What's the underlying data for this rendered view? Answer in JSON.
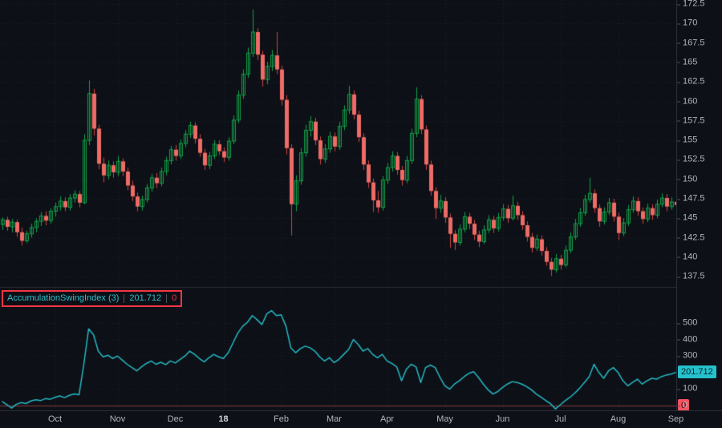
{
  "colors": {
    "bg": "#0d1016",
    "grid": "#1e232d",
    "axis_text": "#b2b5be",
    "axis_text_major": "#d1d4dc",
    "pane_border": "#2a2e39",
    "up": "#12a049",
    "down_body": "#ee6b66",
    "down_wick": "#cc4441",
    "line": "#25b8c4",
    "zero_line": "#8a3a3a",
    "selection_border": "#f23645",
    "value_box_bg": "#25c1cc",
    "value_box_text": "#072329",
    "zero_box_bg": "#f7525f",
    "zero_box_text": "#2b0a0d"
  },
  "indicator": {
    "name": "AccumulationSwingIndex (3)",
    "value": "201.712",
    "zero_value": "0"
  },
  "chart_data": [
    {
      "type": "candlestick",
      "title": "",
      "ylim": [
        136.2,
        173.0
      ],
      "grid": true,
      "y_ticks": [
        172.5,
        170,
        167.5,
        165,
        162.5,
        160,
        157.5,
        155,
        152.5,
        150,
        147.5,
        145,
        142.5,
        140,
        137.5
      ],
      "x_ticks": [
        {
          "index": 11,
          "label": "Oct"
        },
        {
          "index": 24,
          "label": "Nov"
        },
        {
          "index": 36,
          "label": "Dec"
        },
        {
          "index": 46,
          "label": "18",
          "major": true
        },
        {
          "index": 58,
          "label": "Feb"
        },
        {
          "index": 69,
          "label": "Mar"
        },
        {
          "index": 80,
          "label": "Apr"
        },
        {
          "index": 92,
          "label": "May"
        },
        {
          "index": 104,
          "label": "Jun"
        },
        {
          "index": 116,
          "label": "Jul"
        },
        {
          "index": 128,
          "label": "Aug"
        },
        {
          "index": 140,
          "label": "Sep"
        }
      ],
      "candles_format": [
        "open",
        "high",
        "low",
        "close"
      ],
      "candles": [
        [
          144.2,
          145.1,
          143.5,
          144.8
        ],
        [
          144.8,
          145.2,
          143.4,
          143.9
        ],
        [
          143.9,
          144.9,
          143.2,
          144.5
        ],
        [
          144.5,
          144.8,
          142.6,
          143.2
        ],
        [
          143.2,
          143.8,
          141.5,
          142.1
        ],
        [
          142.1,
          143.4,
          141.8,
          143.0
        ],
        [
          143.0,
          144.3,
          142.5,
          143.8
        ],
        [
          143.8,
          145.0,
          143.2,
          144.6
        ],
        [
          144.6,
          145.8,
          144.0,
          145.3
        ],
        [
          145.3,
          145.9,
          144.1,
          144.7
        ],
        [
          144.7,
          146.3,
          144.3,
          145.9
        ],
        [
          145.9,
          147.0,
          145.2,
          146.5
        ],
        [
          146.5,
          147.8,
          146.0,
          147.2
        ],
        [
          147.2,
          147.7,
          145.9,
          146.4
        ],
        [
          146.4,
          148.1,
          146.0,
          147.6
        ],
        [
          147.6,
          148.6,
          147.0,
          148.1
        ],
        [
          148.1,
          148.5,
          146.4,
          147.0
        ],
        [
          147.0,
          155.8,
          146.8,
          155.0
        ],
        [
          155.0,
          162.7,
          154.4,
          161.0
        ],
        [
          161.0,
          161.6,
          155.6,
          156.5
        ],
        [
          156.5,
          157.0,
          151.3,
          152.0
        ],
        [
          152.0,
          152.8,
          149.6,
          150.5
        ],
        [
          150.5,
          152.4,
          150.0,
          151.8
        ],
        [
          151.8,
          152.3,
          150.2,
          150.9
        ],
        [
          150.9,
          153.0,
          150.4,
          152.3
        ],
        [
          152.3,
          152.7,
          150.4,
          151.0
        ],
        [
          151.0,
          151.5,
          148.6,
          149.2
        ],
        [
          149.2,
          149.8,
          147.2,
          147.8
        ],
        [
          147.8,
          148.3,
          145.9,
          146.5
        ],
        [
          146.5,
          147.9,
          146.0,
          147.4
        ],
        [
          147.4,
          149.4,
          147.0,
          148.9
        ],
        [
          148.9,
          150.7,
          148.4,
          150.2
        ],
        [
          150.2,
          150.8,
          148.9,
          149.5
        ],
        [
          149.5,
          151.5,
          149.1,
          151.0
        ],
        [
          151.0,
          152.9,
          150.5,
          152.4
        ],
        [
          152.4,
          154.3,
          151.9,
          153.8
        ],
        [
          153.8,
          154.4,
          152.4,
          153.0
        ],
        [
          153.0,
          155.1,
          152.6,
          154.6
        ],
        [
          154.6,
          156.3,
          154.1,
          155.8
        ],
        [
          155.8,
          157.4,
          155.3,
          156.9
        ],
        [
          156.9,
          157.3,
          154.6,
          155.2
        ],
        [
          155.2,
          155.8,
          152.9,
          153.4
        ],
        [
          153.4,
          153.9,
          151.2,
          151.8
        ],
        [
          151.8,
          153.5,
          151.3,
          153.0
        ],
        [
          153.0,
          155.0,
          152.6,
          154.5
        ],
        [
          154.5,
          155.0,
          153.1,
          153.6
        ],
        [
          153.6,
          154.1,
          152.2,
          152.8
        ],
        [
          152.8,
          155.4,
          152.4,
          154.9
        ],
        [
          154.9,
          158.2,
          154.5,
          157.6
        ],
        [
          157.6,
          161.4,
          157.2,
          160.8
        ],
        [
          160.8,
          164.1,
          160.3,
          163.5
        ],
        [
          163.5,
          166.9,
          163.0,
          166.2
        ],
        [
          166.2,
          171.8,
          165.7,
          168.9
        ],
        [
          168.9,
          169.4,
          165.3,
          166.0
        ],
        [
          166.0,
          166.5,
          161.9,
          162.8
        ],
        [
          162.8,
          165.1,
          162.2,
          164.5
        ],
        [
          164.5,
          166.6,
          163.9,
          165.9
        ],
        [
          165.9,
          168.9,
          163.5,
          164.1
        ],
        [
          164.1,
          164.6,
          159.5,
          160.2
        ],
        [
          160.2,
          160.8,
          153.2,
          154.0
        ],
        [
          154.0,
          154.5,
          142.8,
          146.8
        ],
        [
          146.8,
          150.5,
          145.9,
          149.8
        ],
        [
          149.8,
          154.0,
          149.3,
          153.4
        ],
        [
          153.4,
          157.0,
          152.9,
          156.3
        ],
        [
          156.3,
          158.1,
          155.5,
          157.4
        ],
        [
          157.4,
          157.9,
          154.4,
          155.0
        ],
        [
          155.0,
          155.5,
          151.9,
          152.6
        ],
        [
          152.6,
          154.5,
          152.1,
          153.9
        ],
        [
          153.9,
          156.1,
          153.4,
          155.5
        ],
        [
          155.5,
          156.0,
          153.6,
          154.2
        ],
        [
          154.2,
          157.4,
          153.8,
          156.8
        ],
        [
          156.8,
          159.5,
          156.3,
          158.9
        ],
        [
          158.9,
          162.0,
          158.4,
          160.9
        ],
        [
          160.9,
          161.4,
          157.7,
          158.3
        ],
        [
          158.3,
          158.8,
          154.8,
          155.4
        ],
        [
          155.4,
          155.9,
          151.2,
          151.9
        ],
        [
          151.9,
          152.4,
          148.9,
          149.6
        ],
        [
          149.6,
          150.1,
          145.8,
          147.3
        ],
        [
          147.3,
          148.5,
          145.7,
          146.4
        ],
        [
          146.4,
          150.4,
          146.0,
          149.9
        ],
        [
          149.9,
          152.1,
          149.4,
          151.5
        ],
        [
          151.5,
          153.6,
          151.0,
          153.0
        ],
        [
          153.0,
          153.5,
          150.6,
          151.2
        ],
        [
          151.2,
          151.7,
          149.2,
          149.9
        ],
        [
          149.9,
          153.0,
          149.5,
          152.4
        ],
        [
          152.4,
          156.5,
          152.0,
          155.9
        ],
        [
          155.9,
          161.8,
          155.4,
          160.3
        ],
        [
          160.3,
          160.8,
          155.8,
          156.4
        ],
        [
          156.4,
          156.9,
          151.2,
          151.9
        ],
        [
          151.9,
          152.4,
          147.9,
          148.5
        ],
        [
          148.5,
          149.0,
          144.9,
          146.3
        ],
        [
          146.3,
          148.0,
          145.7,
          147.2
        ],
        [
          147.2,
          147.7,
          144.4,
          145.1
        ],
        [
          145.1,
          145.6,
          141.2,
          143.0
        ],
        [
          143.0,
          143.5,
          140.9,
          141.9
        ],
        [
          141.9,
          144.2,
          141.5,
          143.6
        ],
        [
          143.6,
          145.8,
          143.2,
          145.2
        ],
        [
          145.2,
          145.7,
          143.6,
          144.3
        ],
        [
          144.3,
          144.8,
          142.2,
          142.9
        ],
        [
          142.9,
          143.4,
          141.3,
          142.0
        ],
        [
          142.0,
          144.1,
          141.7,
          143.5
        ],
        [
          143.5,
          145.4,
          143.1,
          144.8
        ],
        [
          144.8,
          145.3,
          143.1,
          143.7
        ],
        [
          143.7,
          145.7,
          143.3,
          145.1
        ],
        [
          145.1,
          146.8,
          144.7,
          146.2
        ],
        [
          146.2,
          146.7,
          144.4,
          145.0
        ],
        [
          145.0,
          147.9,
          144.7,
          146.6
        ],
        [
          146.6,
          147.1,
          144.8,
          145.4
        ],
        [
          145.4,
          145.9,
          143.5,
          144.1
        ],
        [
          144.1,
          144.6,
          142.0,
          142.6
        ],
        [
          142.6,
          143.1,
          140.6,
          141.2
        ],
        [
          141.2,
          142.9,
          140.8,
          142.3
        ],
        [
          142.3,
          142.8,
          140.2,
          140.8
        ],
        [
          140.8,
          141.3,
          138.9,
          139.4
        ],
        [
          139.4,
          139.9,
          137.6,
          138.4
        ],
        [
          138.4,
          140.4,
          138.0,
          139.8
        ],
        [
          139.8,
          140.3,
          138.4,
          139.0
        ],
        [
          139.0,
          141.5,
          138.7,
          140.9
        ],
        [
          140.9,
          143.2,
          140.5,
          142.6
        ],
        [
          142.6,
          144.9,
          142.2,
          144.3
        ],
        [
          144.3,
          146.3,
          143.9,
          145.7
        ],
        [
          145.7,
          148.0,
          145.3,
          147.4
        ],
        [
          147.4,
          150.2,
          147.0,
          148.2
        ],
        [
          148.2,
          148.7,
          145.7,
          146.3
        ],
        [
          146.3,
          146.8,
          143.9,
          144.6
        ],
        [
          144.6,
          146.4,
          144.2,
          145.8
        ],
        [
          145.8,
          147.6,
          145.4,
          147.0
        ],
        [
          147.0,
          147.5,
          144.6,
          145.2
        ],
        [
          145.2,
          145.7,
          142.2,
          143.1
        ],
        [
          143.1,
          145.0,
          142.7,
          144.4
        ],
        [
          144.4,
          146.7,
          144.0,
          146.1
        ],
        [
          146.1,
          147.8,
          145.7,
          147.2
        ],
        [
          147.2,
          147.7,
          145.3,
          145.9
        ],
        [
          145.9,
          146.4,
          144.3,
          144.9
        ],
        [
          144.9,
          146.9,
          144.5,
          146.3
        ],
        [
          146.3,
          146.8,
          144.8,
          145.4
        ],
        [
          145.4,
          147.4,
          145.0,
          146.8
        ],
        [
          146.8,
          148.2,
          146.4,
          147.6
        ],
        [
          147.6,
          148.1,
          145.9,
          146.5
        ],
        [
          146.5,
          147.7,
          146.1,
          147.1
        ],
        [
          147.1,
          147.6,
          146.0,
          146.7
        ]
      ]
    },
    {
      "type": "line",
      "name": "AccumulationSwingIndex (3)",
      "color": "#25b8c4",
      "last_value": 201.712,
      "zero_line": 0,
      "ylim": [
        -30,
        710
      ],
      "y_ticks": [
        500,
        400,
        300,
        100,
        0
      ],
      "values": [
        25,
        5,
        -15,
        8,
        18,
        12,
        28,
        35,
        30,
        42,
        38,
        50,
        58,
        48,
        62,
        70,
        65,
        250,
        465,
        430,
        330,
        295,
        305,
        285,
        300,
        275,
        250,
        230,
        210,
        235,
        255,
        270,
        250,
        262,
        248,
        270,
        258,
        280,
        300,
        330,
        310,
        285,
        265,
        290,
        310,
        295,
        285,
        320,
        380,
        440,
        480,
        505,
        545,
        520,
        490,
        555,
        575,
        545,
        550,
        480,
        350,
        320,
        345,
        360,
        350,
        330,
        295,
        270,
        290,
        260,
        280,
        310,
        340,
        400,
        370,
        330,
        345,
        310,
        290,
        310,
        270,
        255,
        235,
        150,
        220,
        250,
        235,
        140,
        230,
        245,
        230,
        170,
        120,
        100,
        130,
        150,
        175,
        195,
        205,
        170,
        130,
        95,
        70,
        85,
        110,
        130,
        145,
        140,
        130,
        115,
        95,
        70,
        50,
        30,
        10,
        -20,
        5,
        30,
        50,
        75,
        105,
        140,
        175,
        250,
        200,
        165,
        210,
        230,
        200,
        150,
        120,
        140,
        160,
        130,
        150,
        165,
        160,
        175,
        185,
        190,
        201.712
      ]
    }
  ]
}
